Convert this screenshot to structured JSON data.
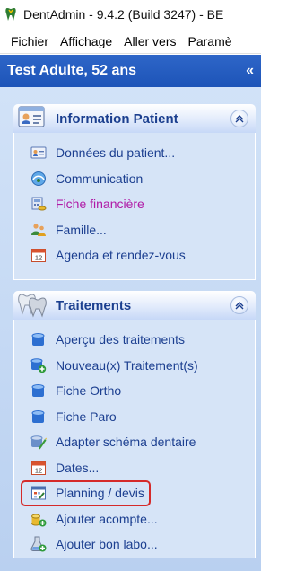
{
  "window": {
    "title": "DentAdmin - 9.4.2     (Build 3247) - BE"
  },
  "menubar": {
    "items": [
      "Fichier",
      "Affichage",
      "Aller vers",
      "Paramè"
    ]
  },
  "patient": {
    "name": "Test Adulte, 52 ans",
    "collapse_glyph": "«"
  },
  "groups": [
    {
      "title": "Information Patient",
      "icon": "patient-card-icon",
      "collapse_glyph": "⌃",
      "items": [
        {
          "label": "Données du patient...",
          "icon": "patient-data-icon"
        },
        {
          "label": "Communication",
          "icon": "communication-icon"
        },
        {
          "label": "Fiche financière",
          "icon": "finance-icon",
          "color": "#b01aa6"
        },
        {
          "label": "Famille...",
          "icon": "family-icon"
        },
        {
          "label": "Agenda et rendez-vous",
          "icon": "calendar-icon"
        }
      ]
    },
    {
      "title": "Traitements",
      "icon": "treatments-icon",
      "collapse_glyph": "⌃",
      "items": [
        {
          "label": "Aperçu des traitements",
          "icon": "tooth-icon"
        },
        {
          "label": "Nouveau(x) Traitement(s)",
          "icon": "tooth-add-icon"
        },
        {
          "label": "Fiche Ortho",
          "icon": "tooth-icon"
        },
        {
          "label": "Fiche Paro",
          "icon": "tooth-icon"
        },
        {
          "label": "Adapter schéma dentaire",
          "icon": "tooth-edit-icon"
        },
        {
          "label": "Dates...",
          "icon": "calendar-icon"
        },
        {
          "label": "Planning / devis",
          "icon": "planning-icon",
          "highlighted": true
        },
        {
          "label": "Ajouter acompte...",
          "icon": "coins-add-icon"
        },
        {
          "label": "Ajouter bon labo...",
          "icon": "lab-add-icon"
        }
      ]
    }
  ],
  "colors": {
    "header": "#1d54b8",
    "link": "#1c3f90",
    "finance_link": "#b01aa6",
    "highlight": "#d52a2a",
    "panel": "#c9dcf5"
  }
}
